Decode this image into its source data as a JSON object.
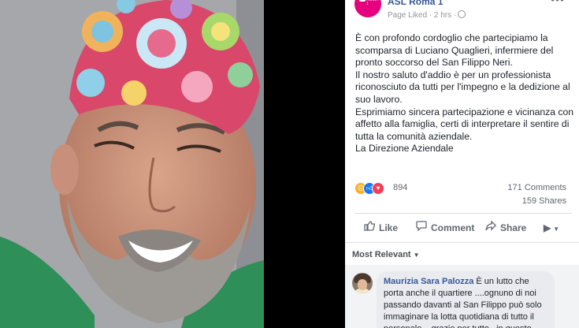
{
  "post": {
    "page_name": "ASL Roma 1",
    "avatar_text": "ASL ROMA 1",
    "meta": "Page Liked · 2 hrs ·",
    "more": "•••",
    "paragraphs": [
      "È con profondo cordoglio che partecipiamo la scomparsa di Luciano Quaglieri, infermiere del pronto soccorso del San Filippo Neri.",
      "Il nostro saluto d'addio è per un professionista riconosciuto da tutti per l'impegno e la dedizione al suo lavoro.",
      "Esprimiamo sincera partecipazione e vicinanza con affetto alla famiglia, certi di interpretare il sentire di tutta la comunità aziendale.",
      "La Direzione Aziendale"
    ]
  },
  "stats": {
    "reaction_count": "894",
    "comments": "171 Comments",
    "shares": "159 Shares",
    "reaction_types": [
      "sad",
      "like",
      "love"
    ]
  },
  "actions": {
    "like": "Like",
    "comment": "Comment",
    "share": "Share"
  },
  "sort": {
    "label": "Most Relevant"
  },
  "comment": {
    "author": "Maurizia Sara Palozza",
    "text": "È un lutto che porta anche il quartiere ....ognuno di noi passando davanti al San Filippo può solo immaginare la lotta quotidiana di tutto il personale....grazie per tutto...in questo"
  },
  "icons": {
    "like": "thumbs-up-icon",
    "comment": "speech-bubble-icon",
    "share": "share-arrow-icon",
    "globe": "globe-icon"
  },
  "colors": {
    "link_blue": "#365899",
    "like_blue": "#1877f2",
    "love_red": "#f33e58",
    "sad_yellow": "#f7b125",
    "brand_pink": "#e6007e"
  }
}
